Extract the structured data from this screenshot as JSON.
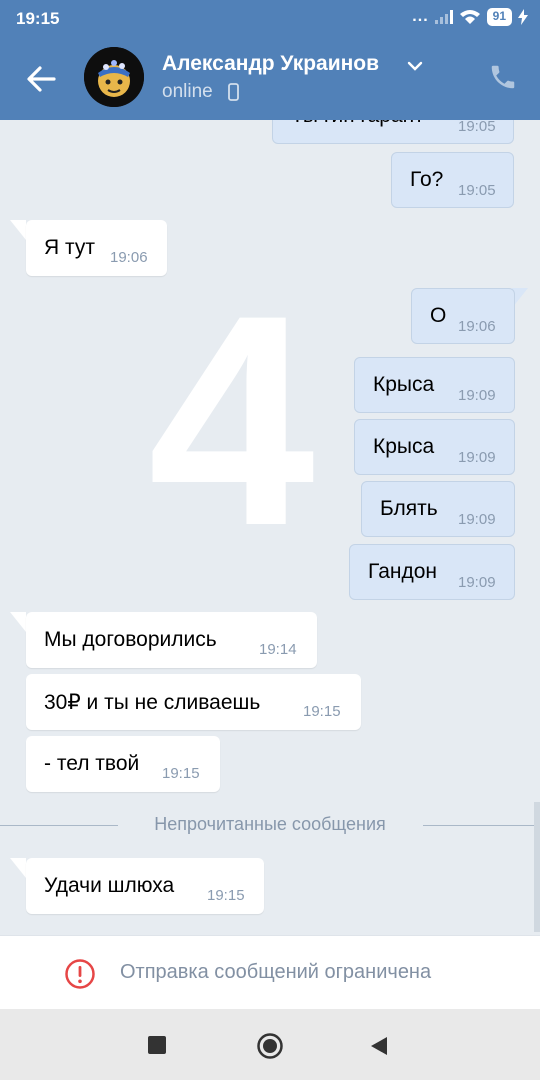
{
  "status_bar": {
    "time": "19:15",
    "dots": "...",
    "battery": "91"
  },
  "header": {
    "contact_name": "Александр Украинов",
    "contact_status": "online"
  },
  "chat": {
    "overlay_number": "4",
    "messages": [
      {
        "dir": "out",
        "text": "Ты гип гарант",
        "time": "19:05"
      },
      {
        "dir": "out",
        "text": "Го?",
        "time": "19:05"
      },
      {
        "dir": "in",
        "text": "Я тут",
        "time": "19:06"
      },
      {
        "dir": "out",
        "text": "О",
        "time": "19:06"
      },
      {
        "dir": "out",
        "text": "Крыса",
        "time": "19:09"
      },
      {
        "dir": "out",
        "text": "Крыса",
        "time": "19:09"
      },
      {
        "dir": "out",
        "text": "Блять",
        "time": "19:09"
      },
      {
        "dir": "out",
        "text": "Гандон",
        "time": "19:09"
      },
      {
        "dir": "in",
        "text": "Мы договорились",
        "time": "19:14"
      },
      {
        "dir": "in",
        "text": "30₽ и ты не сливаешь",
        "time": "19:15"
      },
      {
        "dir": "in",
        "text": "- тел твой",
        "time": "19:15"
      },
      {
        "dir": "in",
        "text": "Удачи шлюха",
        "time": "19:15"
      }
    ],
    "unread_divider": "Непрочитанные сообщения"
  },
  "composer": {
    "restricted_text": "Отправка сообщений ограничена"
  },
  "colors": {
    "header": "#5181b8",
    "background": "#e7ecf1",
    "outgoing": "#d9e6f7",
    "incoming": "#ffffff",
    "warning": "#e64646"
  },
  "icons": [
    "back-arrow-icon",
    "chevron-down-icon",
    "mobile-icon",
    "phone-icon",
    "warning-icon",
    "nav-square-icon",
    "nav-circle-icon",
    "nav-triangle-icon"
  ]
}
